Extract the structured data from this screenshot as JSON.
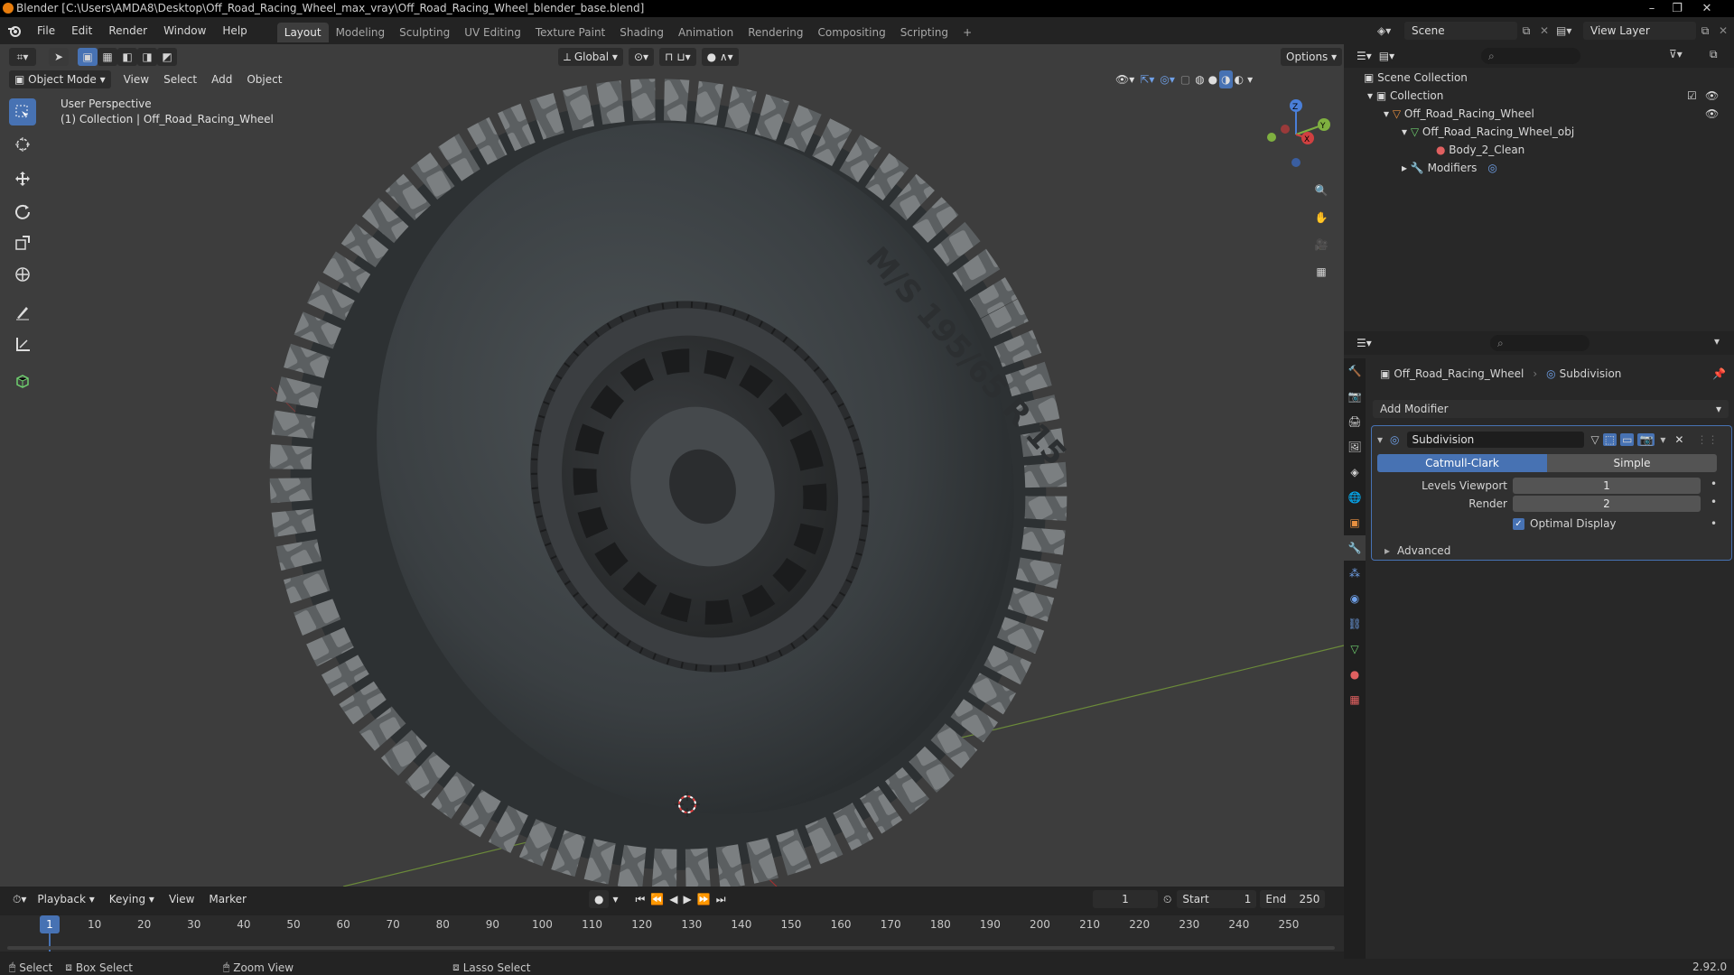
{
  "window": {
    "title": "Blender [C:\\Users\\AMDA8\\Desktop\\Off_Road_Racing_Wheel_max_vray\\Off_Road_Racing_Wheel_blender_base.blend]"
  },
  "menu": [
    "File",
    "Edit",
    "Render",
    "Window",
    "Help"
  ],
  "workspaces": [
    "Layout",
    "Modeling",
    "Sculpting",
    "UV Editing",
    "Texture Paint",
    "Shading",
    "Animation",
    "Rendering",
    "Compositing",
    "Scripting"
  ],
  "scene": {
    "name": "Scene",
    "view_layer": "View Layer"
  },
  "viewport": {
    "mode": "Object Mode",
    "menus": [
      "View",
      "Select",
      "Add",
      "Object"
    ],
    "transform_orientation": "Global",
    "options_label": "Options",
    "perspective": "User Perspective",
    "collection_info": "(1) Collection | Off_Road_Racing_Wheel",
    "tire_text": "M/S 195/65 R 15",
    "gizmo": {
      "z": "Z",
      "y": "Y",
      "x": "X"
    }
  },
  "outliner": {
    "root": "Scene Collection",
    "collection": "Collection",
    "object": "Off_Road_Racing_Wheel",
    "mesh": "Off_Road_Racing_Wheel_obj",
    "material": "Body_2_Clean",
    "modifiers": "Modifiers"
  },
  "properties": {
    "breadcrumb_object": "Off_Road_Racing_Wheel",
    "breadcrumb_modifier": "Subdivision",
    "add_modifier": "Add Modifier",
    "modifier": {
      "name": "Subdivision",
      "type_a": "Catmull-Clark",
      "type_b": "Simple",
      "levels_viewport_label": "Levels Viewport",
      "levels_viewport": "1",
      "render_label": "Render",
      "render": "2",
      "optimal_display": "Optimal Display",
      "advanced": "Advanced"
    }
  },
  "timeline": {
    "menus": [
      "Playback",
      "Keying",
      "View",
      "Marker"
    ],
    "current_frame": "1",
    "start_label": "Start",
    "start": "1",
    "end_label": "End",
    "end": "250",
    "ticks": [
      "1",
      "10",
      "20",
      "30",
      "40",
      "50",
      "60",
      "70",
      "80",
      "90",
      "100",
      "110",
      "120",
      "130",
      "140",
      "150",
      "160",
      "170",
      "180",
      "190",
      "200",
      "210",
      "220",
      "230",
      "240",
      "250"
    ]
  },
  "statusbar": {
    "select": "Select",
    "box_select": "Box Select",
    "zoom_view": "Zoom View",
    "lasso_select": "Lasso Select",
    "version": "2.92.0"
  },
  "colors": {
    "accent": "#4772b3",
    "viewport_bg": "#3d3d3d",
    "panel_bg": "#282828",
    "header_bg": "#232323"
  }
}
